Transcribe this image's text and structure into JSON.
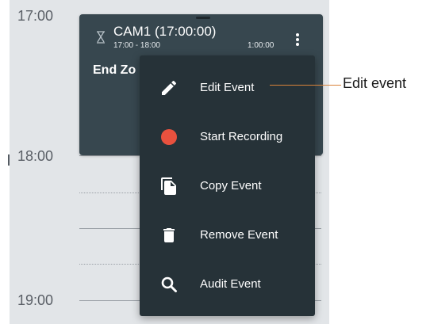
{
  "calendar": {
    "time_labels": [
      "17:00",
      "18:00",
      "19:00"
    ]
  },
  "event": {
    "title": "CAM1 (17:00:00)",
    "time_range": "17:00 - 18:00",
    "duration": "1:00:00",
    "subtitle": "End Zo",
    "card_color": "#37474f"
  },
  "menu": {
    "background": "#263238",
    "items": [
      {
        "label": "Edit Event",
        "icon": "pencil-icon"
      },
      {
        "label": "Start Recording",
        "icon": "record-dot-icon",
        "icon_color": "#e8513e"
      },
      {
        "label": "Copy Event",
        "icon": "copy-icon"
      },
      {
        "label": "Remove Event",
        "icon": "trash-icon"
      },
      {
        "label": "Audit Event",
        "icon": "search-icon"
      }
    ]
  },
  "callout": {
    "label": "Edit event",
    "color": "#d9833a"
  }
}
